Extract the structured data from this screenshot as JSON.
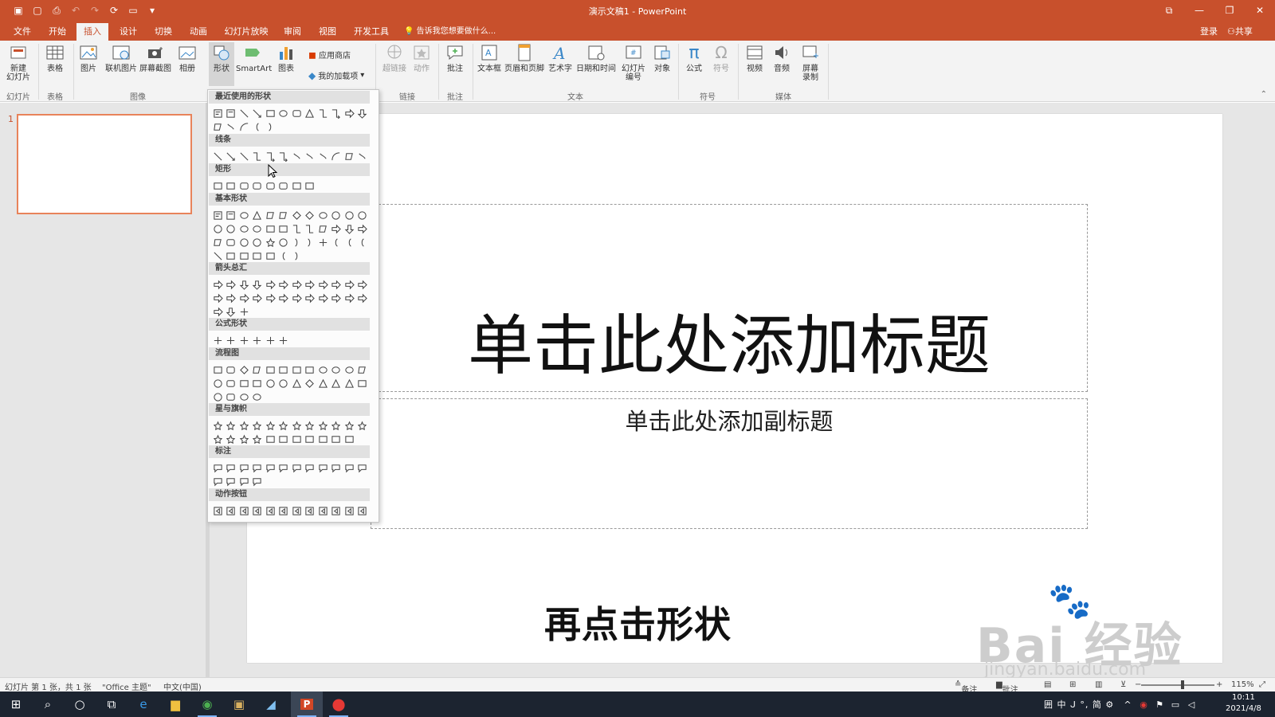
{
  "window": {
    "title": "演示文稿1 - PowerPoint",
    "accent_color": "#c8502c",
    "quick_access": [
      "save-icon",
      "new-icon",
      "print-preview-icon",
      "undo-icon",
      "redo-icon",
      "repeat-icon",
      "open-icon",
      "customize-icon"
    ]
  },
  "tabs": [
    {
      "label": "文件",
      "active": false
    },
    {
      "label": "开始",
      "active": false
    },
    {
      "label": "插入",
      "active": true
    },
    {
      "label": "设计",
      "active": false
    },
    {
      "label": "切换",
      "active": false
    },
    {
      "label": "动画",
      "active": false
    },
    {
      "label": "幻灯片放映",
      "active": false
    },
    {
      "label": "审阅",
      "active": false
    },
    {
      "label": "视图",
      "active": false
    },
    {
      "label": "开发工具",
      "active": false
    }
  ],
  "tell_me": "告诉我您想要做什么...",
  "account": {
    "login": "登录",
    "share": "共享"
  },
  "ribbon": {
    "new_slide": "新建\n幻灯片",
    "table": "表格",
    "picture": "图片",
    "online_picture": "联机图片",
    "screenshot": "屏幕截图",
    "album": "相册",
    "shapes": "形状",
    "smartart": "SmartArt",
    "chart": "图表",
    "store": "应用商店",
    "my_addins": "我的加载项",
    "hyperlink": "超链接",
    "action": "动作",
    "comment": "批注",
    "textbox": "文本框",
    "header_footer": "页眉和页脚",
    "wordart": "艺术字",
    "datetime": "日期和时间",
    "slide_number": "幻灯片\n编号",
    "object": "对象",
    "equation": "公式",
    "symbol": "符号",
    "video": "视频",
    "audio": "音频",
    "screen_recording": "屏幕\n录制",
    "groups": {
      "slides": "幻灯片",
      "tables": "表格",
      "images": "图像",
      "links": "链接",
      "comments": "批注",
      "text": "文本",
      "symbols": "符号",
      "media": "媒体"
    }
  },
  "shape_gallery": {
    "sections": [
      {
        "label": "最近使用的形状"
      },
      {
        "label": "线条"
      },
      {
        "label": "矩形"
      },
      {
        "label": "基本形状"
      },
      {
        "label": "箭头总汇"
      },
      {
        "label": "公式形状"
      },
      {
        "label": "流程图"
      },
      {
        "label": "星与旗帜"
      },
      {
        "label": "标注"
      },
      {
        "label": "动作按钮"
      }
    ]
  },
  "slide_pane": {
    "number": "1"
  },
  "slide": {
    "title_placeholder": "单击此处添加标题",
    "subtitle_placeholder": "单击此处添加副标题"
  },
  "caption": "再点击形状",
  "watermark": {
    "brand": "Bai 经验",
    "url": "jingyan.baidu.com"
  },
  "status": {
    "slide_info": "幻灯片 第 1 张，共 1 张",
    "theme": "\"Office 主题\"",
    "language": "中文(中国)",
    "notes": "备注",
    "comments": "批注",
    "zoom": "115%",
    "zoom_fraction": 0.57
  },
  "taskbar": {
    "tray": "囲 中 ᒍ °, 简 ⚙",
    "time": "10:11",
    "date": "2021/4/8"
  }
}
